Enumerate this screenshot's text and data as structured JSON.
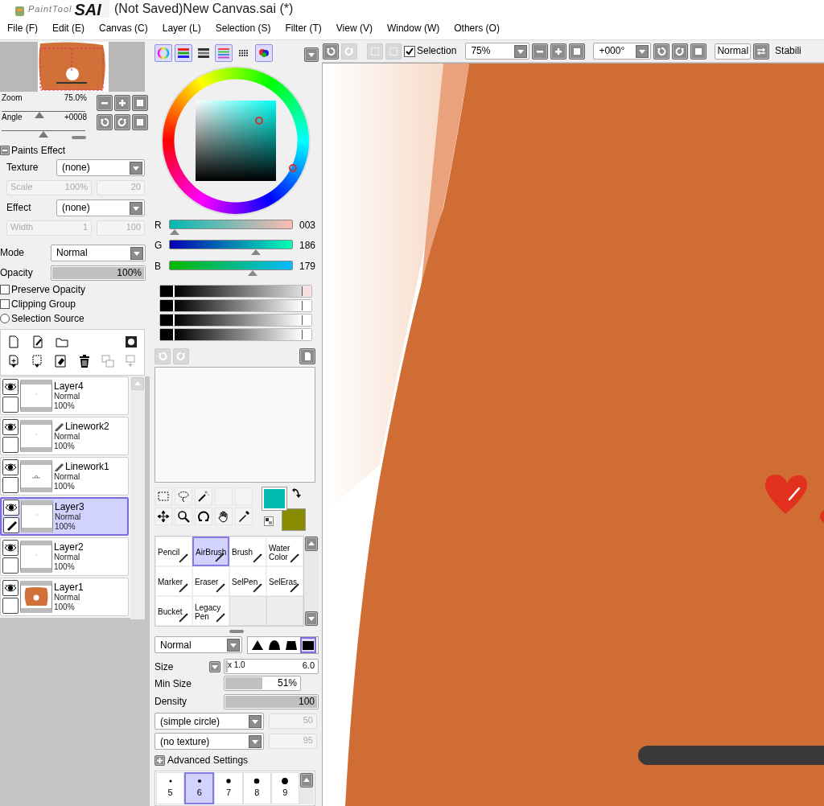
{
  "window": {
    "logo_small": "PaintTool",
    "logo_big": "SAI",
    "title": "(Not Saved)New Canvas.sai (*)"
  },
  "menu": [
    "File (F)",
    "Edit (E)",
    "Canvas (C)",
    "Layer (L)",
    "Selection (S)",
    "Filter (T)",
    "View (V)",
    "Window (W)",
    "Others (O)"
  ],
  "navigator": {
    "zoom": {
      "label": "Zoom",
      "value": "75.0%",
      "level": 0.45
    },
    "angle": {
      "label": "Angle",
      "value": "+0008",
      "level": 0.5
    }
  },
  "paints_effect": {
    "title": "Paints Effect",
    "expanded": true,
    "texture": {
      "label": "Texture",
      "value": "(none)"
    },
    "scale": {
      "label": "Scale",
      "value": "100%",
      "amount": "20",
      "disabled": true
    },
    "effect": {
      "label": "Effect",
      "value": "(none)"
    },
    "width": {
      "label": "Width",
      "value": "1",
      "amount": "100",
      "disabled": true
    }
  },
  "layer_options": {
    "mode": {
      "label": "Mode",
      "value": "Normal"
    },
    "opacity": {
      "label": "Opacity",
      "value": "100%",
      "level": 1
    },
    "options": [
      {
        "kind": "checkbox",
        "label": "Preserve Opacity",
        "checked": false
      },
      {
        "kind": "checkbox",
        "label": "Clipping Group",
        "checked": false
      },
      {
        "kind": "radio",
        "label": "Selection Source",
        "checked": false
      }
    ]
  },
  "layers": [
    {
      "name": "Layer4",
      "mode": "Normal",
      "opacity": "100%",
      "visible": true,
      "linework": false,
      "kind": "blank",
      "selected": false
    },
    {
      "name": "Linework2",
      "mode": "Normal",
      "opacity": "100%",
      "visible": true,
      "linework": true,
      "kind": "blank",
      "selected": false
    },
    {
      "name": "Linework1",
      "mode": "Normal",
      "opacity": "100%",
      "visible": true,
      "linework": true,
      "kind": "sketch",
      "selected": false
    },
    {
      "name": "Layer3",
      "mode": "Normal",
      "opacity": "100%",
      "visible": true,
      "linework": false,
      "kind": "blank",
      "selected": true
    },
    {
      "name": "Layer2",
      "mode": "Normal",
      "opacity": "100%",
      "visible": true,
      "linework": false,
      "kind": "blank",
      "selected": false
    },
    {
      "name": "Layer1",
      "mode": "Normal",
      "opacity": "100%",
      "visible": true,
      "linework": false,
      "kind": "filled",
      "selected": false
    }
  ],
  "color": {
    "modes": [
      {
        "on": true
      },
      {
        "on": true
      },
      {
        "on": false
      },
      {
        "on": true
      },
      {
        "on": false
      },
      {
        "on": true
      }
    ],
    "rgb": [
      {
        "label": "R",
        "value": "003",
        "level": 0.01
      },
      {
        "label": "G",
        "value": "186",
        "level": 0.73
      },
      {
        "label": "B",
        "value": "179",
        "level": 0.7
      }
    ],
    "scratch_sliders": [
      {
        "level": 0.93
      },
      {
        "level": 0.93
      },
      {
        "level": 0.93
      },
      {
        "level": 0.93
      }
    ],
    "swatches": [
      {
        "kind": "foreground",
        "color": "#03bab3"
      },
      {
        "kind": "background",
        "color": "#8a8c00"
      }
    ]
  },
  "brushes": [
    {
      "name": "Pencil",
      "selected": false
    },
    {
      "name": "AirBrush",
      "selected": true
    },
    {
      "name": "Brush",
      "selected": false
    },
    {
      "name": "Water Color",
      "selected": false
    },
    {
      "name": "Marker",
      "selected": false
    },
    {
      "name": "Eraser",
      "selected": false
    },
    {
      "name": "SelPen",
      "selected": false
    },
    {
      "name": "SelEras",
      "selected": false
    },
    {
      "name": "Bucket",
      "selected": false
    },
    {
      "name": "Legacy Pen",
      "selected": false
    }
  ],
  "brush_settings": {
    "blend": "Normal",
    "shapes": [
      {
        "selected": false
      },
      {
        "selected": false
      },
      {
        "selected": false
      },
      {
        "selected": true
      }
    ],
    "size": {
      "label": "Size",
      "multiplier": "x 1.0",
      "value": "6.0",
      "level": 0.04
    },
    "min_size": {
      "label": "Min Size",
      "value": "51%",
      "level": 0.51
    },
    "density": {
      "label": "Density",
      "value": "100",
      "level": 1
    },
    "shape": {
      "value": "(simple circle)",
      "amount": "50"
    },
    "texture": {
      "value": "(no texture)",
      "amount": "95"
    },
    "advanced": {
      "label": "Advanced Settings",
      "expanded": false
    }
  },
  "sizes": [
    {
      "label": "5",
      "selected": false
    },
    {
      "label": "6",
      "selected": true
    },
    {
      "label": "7",
      "selected": false
    },
    {
      "label": "8",
      "selected": false
    },
    {
      "label": "9",
      "selected": false
    }
  ],
  "canvas_toolbar": {
    "selection": {
      "label": "Selection",
      "checked": true
    },
    "zoom": "75%",
    "angle": "+000°",
    "mode": "Normal",
    "stabilizer": "Stabili"
  }
}
